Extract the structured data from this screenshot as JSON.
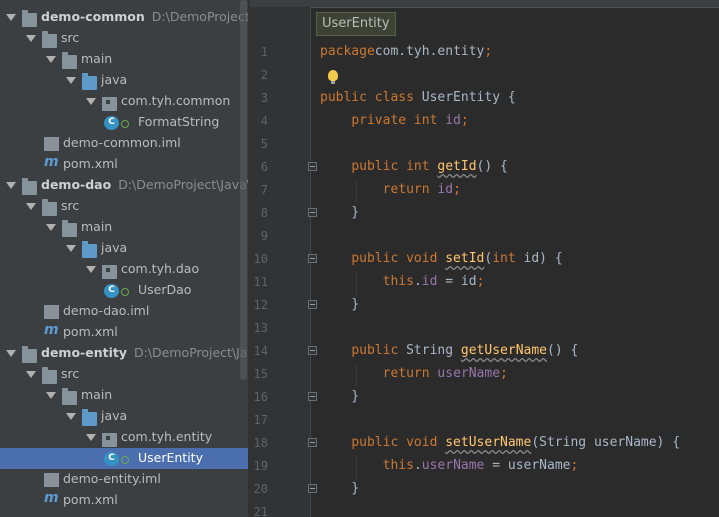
{
  "tree": [
    {
      "depth": 0,
      "kind": "module",
      "name": "demo-common",
      "path": "D:\\DemoProject\\Ja",
      "expanded": true
    },
    {
      "depth": 1,
      "kind": "folder",
      "name": "src",
      "expanded": true
    },
    {
      "depth": 2,
      "kind": "folder",
      "name": "main",
      "expanded": true
    },
    {
      "depth": 3,
      "kind": "srcfolder",
      "name": "java",
      "expanded": true
    },
    {
      "depth": 4,
      "kind": "package",
      "name": "com.tyh.common",
      "expanded": true
    },
    {
      "depth": 5,
      "kind": "class",
      "name": "FormatString"
    },
    {
      "depth": 1,
      "kind": "iml",
      "name": "demo-common.iml"
    },
    {
      "depth": 1,
      "kind": "pom",
      "name": "pom.xml"
    },
    {
      "depth": 0,
      "kind": "module",
      "name": "demo-dao",
      "path": "D:\\DemoProject\\Java\\D",
      "expanded": true
    },
    {
      "depth": 1,
      "kind": "folder",
      "name": "src",
      "expanded": true
    },
    {
      "depth": 2,
      "kind": "folder",
      "name": "main",
      "expanded": true
    },
    {
      "depth": 3,
      "kind": "srcfolder",
      "name": "java",
      "expanded": true
    },
    {
      "depth": 4,
      "kind": "package",
      "name": "com.tyh.dao",
      "expanded": true
    },
    {
      "depth": 5,
      "kind": "class",
      "name": "UserDao"
    },
    {
      "depth": 1,
      "kind": "iml",
      "name": "demo-dao.iml"
    },
    {
      "depth": 1,
      "kind": "pom",
      "name": "pom.xml"
    },
    {
      "depth": 0,
      "kind": "module",
      "name": "demo-entity",
      "path": "D:\\DemoProject\\Java",
      "expanded": true
    },
    {
      "depth": 1,
      "kind": "folder",
      "name": "src",
      "expanded": true
    },
    {
      "depth": 2,
      "kind": "folder",
      "name": "main",
      "expanded": true
    },
    {
      "depth": 3,
      "kind": "srcfolder",
      "name": "java",
      "expanded": true
    },
    {
      "depth": 4,
      "kind": "package",
      "name": "com.tyh.entity",
      "expanded": true
    },
    {
      "depth": 5,
      "kind": "class",
      "name": "UserEntity",
      "selected": true
    },
    {
      "depth": 1,
      "kind": "iml",
      "name": "demo-entity.iml"
    },
    {
      "depth": 1,
      "kind": "pom",
      "name": "pom.xml"
    }
  ],
  "breadcrumb": "UserEntity",
  "code": [
    {
      "n": "1",
      "t": [
        [
          "kw",
          "package"
        ],
        [
          "",
          "com.tyh.entity"
        ],
        [
          "kw",
          ";"
        ]
      ]
    },
    {
      "n": "2",
      "t": []
    },
    {
      "n": "3",
      "t": [
        [
          "kw",
          "public class "
        ],
        [
          "",
          "UserEntity {"
        ]
      ]
    },
    {
      "n": "4",
      "t": [
        [
          "",
          "    "
        ],
        [
          "kw",
          "private int "
        ],
        [
          "fld",
          "id"
        ],
        [
          "kw",
          ";"
        ]
      ]
    },
    {
      "n": "5",
      "t": []
    },
    {
      "n": "6",
      "t": [
        [
          "",
          "    "
        ],
        [
          "kw",
          "public int "
        ],
        [
          "fnw",
          "getId"
        ],
        [
          "",
          "() {"
        ]
      ]
    },
    {
      "n": "7",
      "t": [
        [
          "",
          "        "
        ],
        [
          "kw",
          "return "
        ],
        [
          "fld",
          "id"
        ],
        [
          "kw",
          ";"
        ]
      ]
    },
    {
      "n": "8",
      "t": [
        [
          "",
          "    }"
        ]
      ]
    },
    {
      "n": "9",
      "t": []
    },
    {
      "n": "10",
      "t": [
        [
          "",
          "    "
        ],
        [
          "kw",
          "public void "
        ],
        [
          "fnw",
          "setId"
        ],
        [
          "",
          "("
        ],
        [
          "kw",
          "int "
        ],
        [
          "",
          "id) {"
        ]
      ]
    },
    {
      "n": "11",
      "t": [
        [
          "",
          "        "
        ],
        [
          "kw",
          "this"
        ],
        [
          "",
          "."
        ],
        [
          "fld",
          "id"
        ],
        [
          "",
          " = id"
        ],
        [
          "kw",
          ";"
        ]
      ]
    },
    {
      "n": "12",
      "t": [
        [
          "",
          "    }"
        ]
      ]
    },
    {
      "n": "13",
      "t": []
    },
    {
      "n": "14",
      "t": [
        [
          "",
          "    "
        ],
        [
          "kw",
          "public "
        ],
        [
          "",
          "String "
        ],
        [
          "fnw",
          "getUserName"
        ],
        [
          "",
          "() {"
        ]
      ]
    },
    {
      "n": "15",
      "t": [
        [
          "",
          "        "
        ],
        [
          "kw",
          "return "
        ],
        [
          "fld",
          "userName"
        ],
        [
          "kw",
          ";"
        ]
      ]
    },
    {
      "n": "16",
      "t": [
        [
          "",
          "    }"
        ]
      ]
    },
    {
      "n": "17",
      "t": []
    },
    {
      "n": "18",
      "t": [
        [
          "",
          "    "
        ],
        [
          "kw",
          "public void "
        ],
        [
          "fnw",
          "setUserName"
        ],
        [
          "",
          "(String userName) {"
        ]
      ]
    },
    {
      "n": "19",
      "t": [
        [
          "",
          "        "
        ],
        [
          "kw",
          "this"
        ],
        [
          "",
          "."
        ],
        [
          "fld",
          "userName"
        ],
        [
          "",
          " = userName"
        ],
        [
          "kw",
          ";"
        ]
      ]
    },
    {
      "n": "20",
      "t": [
        [
          "",
          "    }"
        ]
      ]
    },
    {
      "n": "21",
      "t": []
    }
  ]
}
